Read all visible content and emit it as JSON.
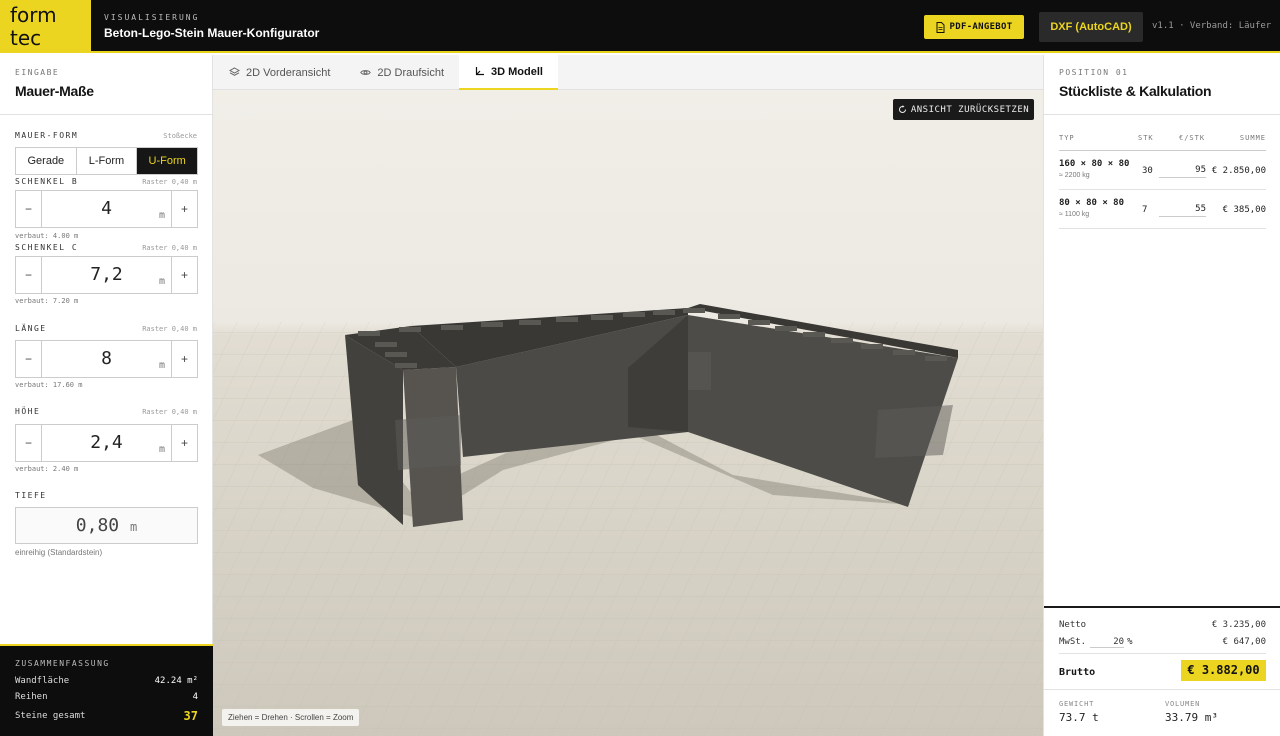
{
  "header": {
    "logo_line1": "form",
    "logo_line2": "tec",
    "kicker": "VISUALISIERUNG",
    "title": "Beton-Lego-Stein Mauer-Konfigurator",
    "pdf_button": "PDF-ANGEBOT",
    "dxf_button": "DXF (AutoCAD)",
    "version": "v1.1 · Verband: Läufer"
  },
  "left": {
    "kicker": "EINGABE",
    "title": "Mauer-Maße",
    "shape_label": "MAUER-FORM",
    "shape_note": "Stoßecke",
    "shape_options": [
      "Gerade",
      "L-Form",
      "U-Form"
    ],
    "shape_selected": "U-Form",
    "schenkel_b": {
      "label": "SCHENKEL B",
      "note": "Raster 0,40 m",
      "value": "4",
      "unit": "m",
      "verbaut": "verbaut: 4.00 m"
    },
    "schenkel_c": {
      "label": "SCHENKEL C",
      "note": "Raster 0,40 m",
      "value": "7,2",
      "unit": "m",
      "verbaut": "verbaut: 7.20 m"
    },
    "laenge": {
      "label": "LÄNGE",
      "note": "Raster 0,40 m",
      "value": "8",
      "unit": "m",
      "verbaut": "verbaut: 17.60 m"
    },
    "hoehe": {
      "label": "HÖHE",
      "note": "Raster 0,40 m",
      "value": "2,4",
      "unit": "m",
      "verbaut": "verbaut: 2.40 m"
    },
    "tiefe": {
      "label": "TIEFE",
      "value": "0,80",
      "unit": "m",
      "note": "einreihig (Standardstein)"
    },
    "minus": "−",
    "plus": "+"
  },
  "summary": {
    "kicker": "ZUSAMMENFASSUNG",
    "rows": [
      {
        "label": "Wandfläche",
        "value": "42.24 m²"
      },
      {
        "label": "Reihen",
        "value": "4"
      },
      {
        "label": "Steine gesamt",
        "value": "37"
      }
    ]
  },
  "tabs": [
    {
      "label": "2D Vorderansicht",
      "icon": "layers-icon"
    },
    {
      "label": "2D Draufsicht",
      "icon": "eye-icon"
    },
    {
      "label": "3D Modell",
      "icon": "axes-icon",
      "active": true
    }
  ],
  "viewport": {
    "reset_button": "ANSICHT ZURÜCKSETZEN",
    "hint": "Ziehen = Drehen · Scrollen = Zoom"
  },
  "right": {
    "kicker": "POSITION 01",
    "title": "Stückliste & Kalkulation",
    "columns": [
      "TYP",
      "STK",
      "€/STK",
      "SUMME"
    ],
    "rows": [
      {
        "typ": "160 × 80 × 80",
        "weight": "≈ 2200 kg",
        "stk": "30",
        "eur": "95",
        "sum": "€ 2.850,00"
      },
      {
        "typ": "80 × 80 × 80",
        "weight": "≈ 1100 kg",
        "stk": "7",
        "eur": "55",
        "sum": "€ 385,00"
      }
    ],
    "netto_label": "Netto",
    "netto_value": "€ 3.235,00",
    "mwst_label": "MwSt.",
    "mwst_rate": "20",
    "mwst_pct": "%",
    "mwst_value": "€ 647,00",
    "brutto_label": "Brutto",
    "brutto_value": "€ 3.882,00",
    "gewicht_label": "GEWICHT",
    "gewicht_value": "73.7 t",
    "volumen_label": "VOLUMEN",
    "volumen_value": "33.79 m³"
  },
  "colors": {
    "accent": "#ecd521",
    "dark": "#0d0d0d",
    "wall": "#4a4845",
    "floor": "#cfcbbd"
  }
}
